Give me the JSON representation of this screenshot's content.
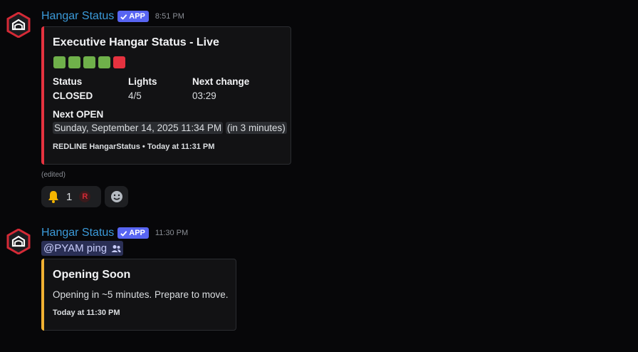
{
  "messages": [
    {
      "author": "Hangar Status",
      "badge": "APP",
      "timestamp": "8:51 PM",
      "embed": {
        "accent": "#e5323f",
        "title": "Executive Hangar Status - Live",
        "lights": [
          "#6fb04a",
          "#6fb04a",
          "#6fb04a",
          "#6fb04a",
          "#e5323f"
        ],
        "fields": [
          {
            "name": "Status",
            "value": "CLOSED",
            "bold": true
          },
          {
            "name": "Lights",
            "value": "4/5"
          },
          {
            "name": "Next change",
            "value": "03:29"
          }
        ],
        "next_open_label": "Next OPEN",
        "next_open_date": "Sunday, September 14, 2025 11:34 PM",
        "next_open_relative": "in 3 minutes",
        "footer": "REDLINE HangarStatus • Today at 11:31 PM"
      },
      "edited": "(edited)",
      "reactions": [
        {
          "icon": "bell-emoji",
          "count": "1"
        },
        {
          "icon": "add-reaction-icon"
        }
      ]
    },
    {
      "author": "Hangar Status",
      "badge": "APP",
      "timestamp": "11:30 PM",
      "mention": "@PYAM ping",
      "embed": {
        "accent": "#f0b132",
        "title": "Opening Soon",
        "description": "Opening in ~5 minutes. Prepare to move.",
        "footer": "Today at 11:30 PM"
      }
    }
  ]
}
